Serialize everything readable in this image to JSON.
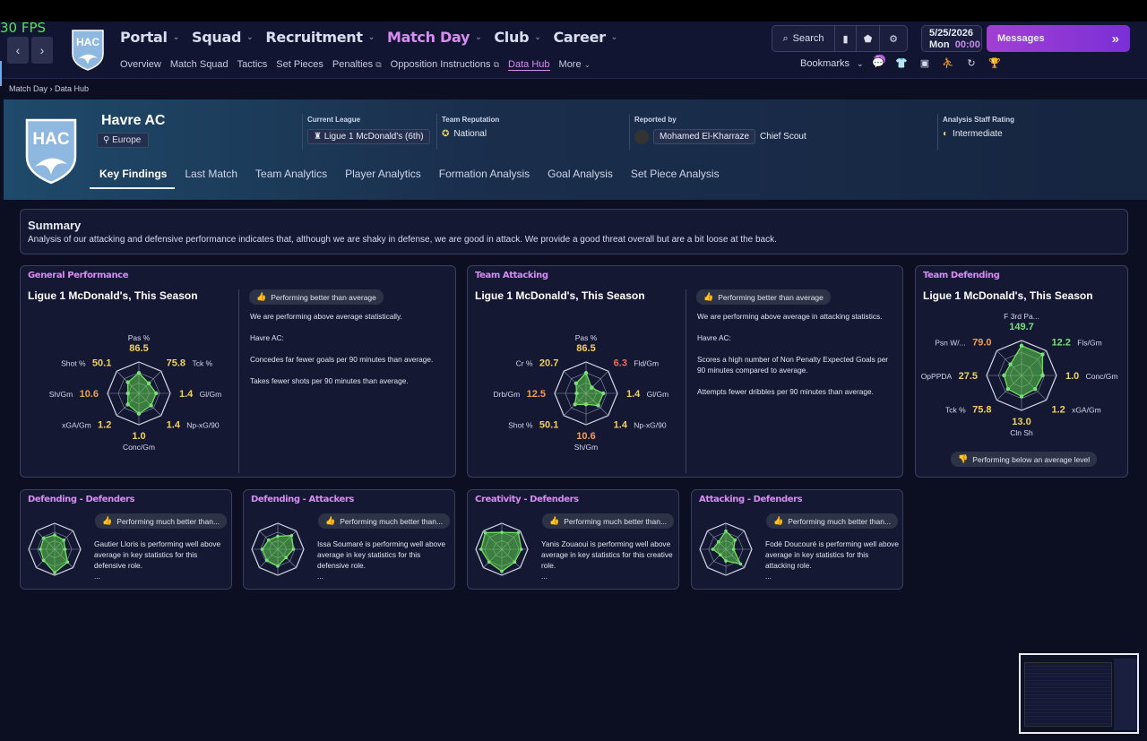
{
  "overlay": {
    "fps": "30 FPS"
  },
  "header": {
    "club_abbr": "HAC",
    "main_nav": [
      {
        "label": "Portal",
        "active": false
      },
      {
        "label": "Squad",
        "active": false
      },
      {
        "label": "Recruitment",
        "active": false
      },
      {
        "label": "Match Day",
        "active": true
      },
      {
        "label": "Club",
        "active": false
      },
      {
        "label": "Career",
        "active": false
      }
    ],
    "sub_nav": [
      "Overview",
      "Match Squad",
      "Tactics",
      "Set Pieces",
      "Penalties",
      "Opposition Instructions",
      "Data Hub",
      "More"
    ],
    "sub_nav_active": "Data Hub",
    "search_label": "Search",
    "date": "5/25/2026",
    "day": "Mon",
    "time": "00:00",
    "messages_label": "Messages",
    "bookmarks_label": "Bookmarks",
    "notif_badge": "9+"
  },
  "breadcrumb": {
    "parent": "Match Day",
    "current": "Data Hub"
  },
  "club": {
    "name": "Havre AC",
    "region": "Europe",
    "league_label": "Current League",
    "league_value": "Ligue 1 McDonald's (6th)",
    "reputation_label": "Team Reputation",
    "reputation_value": "National",
    "reported_label": "Reported by",
    "reported_name": "Mohamed El-Kharraze",
    "reported_role": "Chief Scout",
    "rating_label": "Analysis Staff Rating",
    "rating_value": "Intermediate"
  },
  "tabs": [
    "Key Findings",
    "Last Match",
    "Team Analytics",
    "Player Analytics",
    "Formation Analysis",
    "Goal Analysis",
    "Set Piece Analysis"
  ],
  "summary": {
    "title": "Summary",
    "text": "Analysis of our attacking and defensive performance indicates that, although we are shaky in defense, we are good in attack. We provide a good threat overall but are a bit loose at the back."
  },
  "general": {
    "title": "General Performance",
    "subtitle": "Ligue 1 McDonald's, This Season",
    "pill": "Performing better than average",
    "p1": "We are performing above average statistically.",
    "p2": "Havre AC:",
    "p3": "Concedes far fewer goals per 90 minutes than average.",
    "p4": "Takes fewer shots per 90 minutes than average.",
    "radar": [
      {
        "label": "Pas %",
        "value": "86.5",
        "color": "#f2d060",
        "level": 0.65
      },
      {
        "label": "Tck %",
        "value": "75.8",
        "color": "#f2d060",
        "level": 0.45
      },
      {
        "label": "Gl/Gm",
        "value": "1.4",
        "color": "#f2d060",
        "level": 0.55
      },
      {
        "label": "Np-xG/90",
        "value": "1.4",
        "color": "#f2d060",
        "level": 0.55
      },
      {
        "label": "Conc/Gm",
        "value": "1.0",
        "color": "#f2d060",
        "level": 0.65
      },
      {
        "label": "xGA/Gm",
        "value": "1.2",
        "color": "#f2d060",
        "level": 0.5
      },
      {
        "label": "Sh/Gm",
        "value": "10.6",
        "color": "#f0a050",
        "level": 0.35
      },
      {
        "label": "Shot %",
        "value": "50.1",
        "color": "#f2d060",
        "level": 0.5
      }
    ]
  },
  "attacking": {
    "title": "Team Attacking",
    "subtitle": "Ligue 1 McDonald's, This Season",
    "pill": "Performing better than average",
    "p1": "We are performing above average in attacking statistics.",
    "p2": "Havre AC:",
    "p3": "Scores a high number of Non Penalty Expected Goals per 90 minutes compared to average.",
    "p4": "Attempts fewer dribbles per 90 minutes than average.",
    "radar": [
      {
        "label": "Pas %",
        "value": "86.5",
        "color": "#f2d060",
        "level": 0.65
      },
      {
        "label": "Fld/Gm",
        "value": "6.3",
        "color": "#f06a5a",
        "level": 0.25
      },
      {
        "label": "Gl/Gm",
        "value": "1.4",
        "color": "#f2d060",
        "level": 0.55
      },
      {
        "label": "Np-xG/90",
        "value": "1.4",
        "color": "#f2d060",
        "level": 0.55
      },
      {
        "label": "Sh/Gm",
        "value": "10.6",
        "color": "#f0a050",
        "level": 0.35
      },
      {
        "label": "Shot %",
        "value": "50.1",
        "color": "#f2d060",
        "level": 0.5
      },
      {
        "label": "Drb/Gm",
        "value": "12.5",
        "color": "#f0a050",
        "level": 0.3
      },
      {
        "label": "Cr %",
        "value": "20.7",
        "color": "#f2d060",
        "level": 0.45
      }
    ]
  },
  "defending": {
    "title": "Team Defending",
    "subtitle": "Ligue 1 McDonald's, This Season",
    "pill": "Performing below an average level",
    "radar": [
      {
        "label": "F 3rd Pa...",
        "value": "149.7",
        "color": "#7be07b",
        "level": 0.85
      },
      {
        "label": "Fls/Gm",
        "value": "12.2",
        "color": "#7be07b",
        "level": 0.85
      },
      {
        "label": "Conc/Gm",
        "value": "1.0",
        "color": "#f2d060",
        "level": 0.6
      },
      {
        "label": "xGA/Gm",
        "value": "1.2",
        "color": "#f2d060",
        "level": 0.55
      },
      {
        "label": "Cln Sh",
        "value": "13.0",
        "color": "#f2d060",
        "level": 0.6
      },
      {
        "label": "Tck %",
        "value": "75.8",
        "color": "#f2d060",
        "level": 0.55
      },
      {
        "label": "OpPPDA",
        "value": "27.5",
        "color": "#f2d060",
        "level": 0.5
      },
      {
        "label": "Psn W/...",
        "value": "79.0",
        "color": "#f0a050",
        "level": 0.45
      }
    ]
  },
  "players": [
    {
      "title": "Defending - Defenders",
      "pill": "Performing much better than...",
      "text": "Gautier Lloris is performing well above average in key statistics for this defensive role.",
      "levels": [
        0.55,
        0.5,
        0.4,
        0.7,
        0.9,
        0.6,
        0.55,
        0.6
      ]
    },
    {
      "title": "Defending - Attackers",
      "pill": "Performing much better than...",
      "text": "Issa Soumaré is performing well above average in key statistics for this defensive role.",
      "levels": [
        0.5,
        0.75,
        0.6,
        0.45,
        0.65,
        0.6,
        0.6,
        0.5
      ]
    },
    {
      "title": "Creativity - Defenders",
      "pill": "Performing much better than...",
      "text": "Yanis Zouaoui is performing well above average in key statistics for this creative role.",
      "levels": [
        0.65,
        0.9,
        0.75,
        0.7,
        0.85,
        0.7,
        0.8,
        0.9
      ]
    },
    {
      "title": "Attacking - Defenders",
      "pill": "Performing much better than...",
      "text": "Fodé Doucouré is performing well above average in key statistics for this attacking role.",
      "levels": [
        0.7,
        0.5,
        0.3,
        0.8,
        0.45,
        0.3,
        0.5,
        0.4
      ]
    }
  ],
  "ellipsis": "...",
  "colors": {
    "accent": "#d88cf2",
    "radar_fill": "#5fd04a",
    "messages": "#a23fd4"
  }
}
